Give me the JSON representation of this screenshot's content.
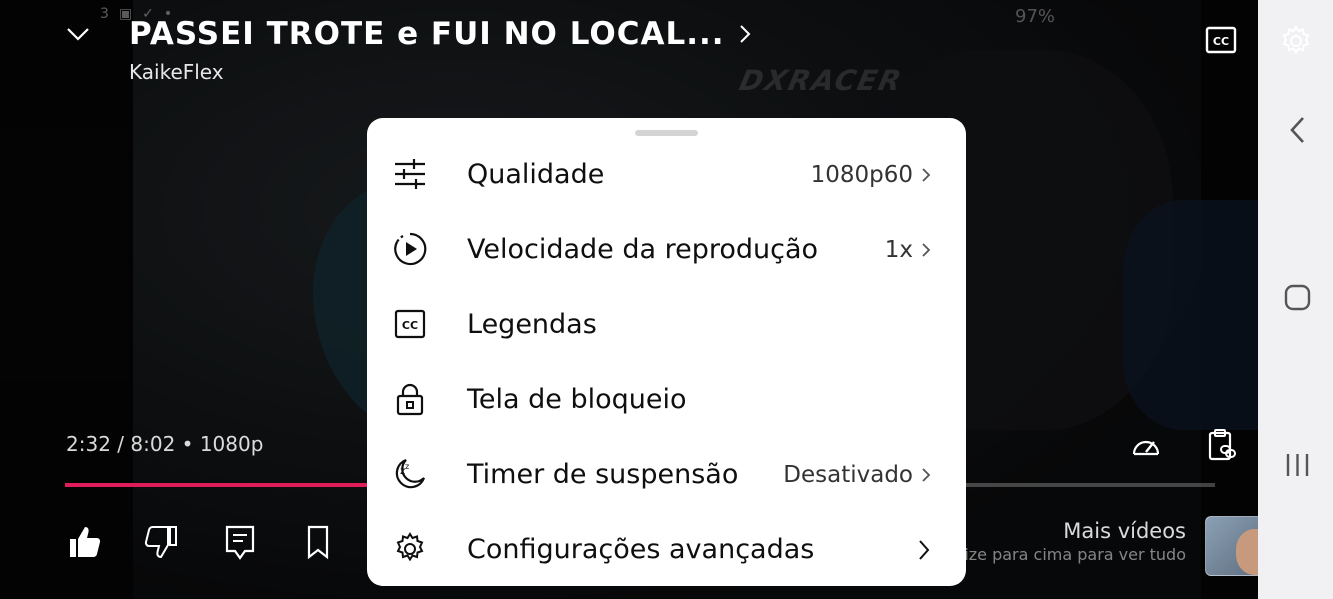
{
  "status_bar": {
    "left_text": "3",
    "right_text": "97%"
  },
  "header": {
    "title": "PASSEI TROTE e FUI NO LOCAL...",
    "channel": "KaikeFlex",
    "watermark": "DXRACER"
  },
  "player": {
    "time_current": "2:32",
    "time_total": "8:02",
    "resolution": "1080p",
    "progress_fraction": 0.316,
    "accent_color": "#e01c5a"
  },
  "more_videos": {
    "title": "Mais vídeos",
    "hint": "deslize para cima para ver tudo"
  },
  "settings_menu": {
    "items": [
      {
        "icon": "sliders-icon",
        "label": "Qualidade",
        "value": "1080p60"
      },
      {
        "icon": "playback-speed-icon",
        "label": "Velocidade da reprodução",
        "value": "1x"
      },
      {
        "icon": "captions-icon",
        "label": "Legendas",
        "value": ""
      },
      {
        "icon": "lock-icon",
        "label": "Tela de bloqueio",
        "value": ""
      },
      {
        "icon": "sleep-timer-icon",
        "label": "Timer de suspensão",
        "value": "Desativado"
      },
      {
        "icon": "gear-icon",
        "label": "Configurações avançadas",
        "value": ""
      }
    ]
  }
}
